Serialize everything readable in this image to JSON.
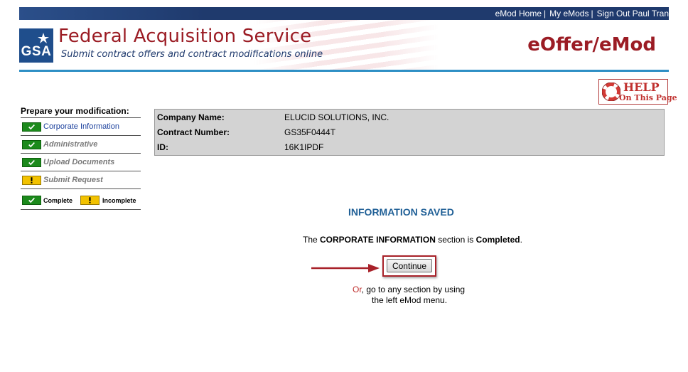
{
  "topnav": {
    "links": [
      "eMod Home",
      "My eMods",
      "Sign Out Paul Tran"
    ],
    "separator": "|"
  },
  "header": {
    "logo_text": "GSA",
    "title": "Federal Acquisition Service",
    "subtitle": "Submit contract offers and contract modifications online",
    "app_name": "eOffer/eMod"
  },
  "help": {
    "line1": "HELP",
    "line2": "On This Page"
  },
  "sidebar": {
    "title": "Prepare your modification:",
    "items": [
      {
        "label": "Corporate Information",
        "status": "complete",
        "icon": "check-icon"
      },
      {
        "label": "Administrative",
        "status": "complete",
        "icon": "check-icon"
      },
      {
        "label": "Upload Documents",
        "status": "complete",
        "icon": "check-icon"
      },
      {
        "label": "Submit Request",
        "status": "incomplete",
        "icon": "exclamation-icon"
      }
    ],
    "legend": {
      "complete_label": "Complete",
      "incomplete_label": "Incomplete"
    }
  },
  "company": {
    "rows": [
      {
        "label": "Company Name:",
        "value": "ELUCID SOLUTIONS, INC."
      },
      {
        "label": "Contract Number:",
        "value": "GS35F0444T"
      },
      {
        "label": "ID:",
        "value": "16K1IPDF"
      }
    ]
  },
  "main": {
    "heading": "INFORMATION SAVED",
    "msg_prefix": "The ",
    "msg_section": "CORPORATE INFORMATION",
    "msg_middle": " section is ",
    "msg_status": "Completed",
    "msg_suffix": ".",
    "continue_label": "Continue",
    "or_word": "Or",
    "or_rest": ", go to any section by using",
    "or_line2": "the left eMod menu."
  },
  "colors": {
    "brand_red": "#9b1c24",
    "nav_blue": "#1f3a6d",
    "accent_blue": "#2e8fc5",
    "complete_green": "#1c8a1c",
    "incomplete_yellow": "#f2c200"
  }
}
